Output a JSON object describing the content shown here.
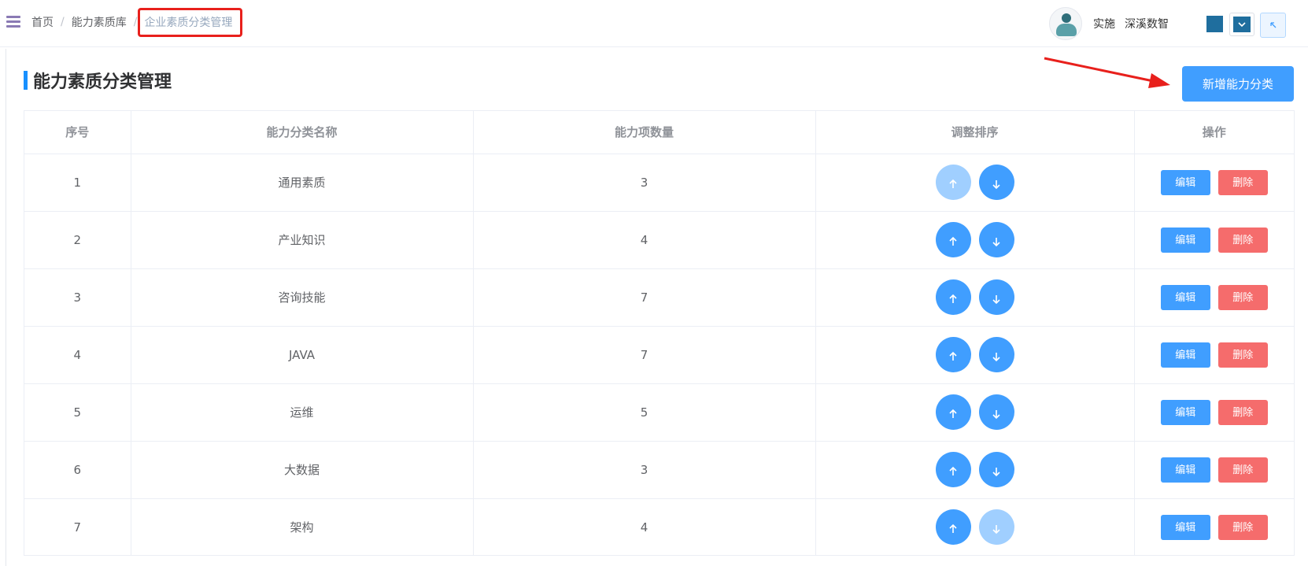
{
  "breadcrumb": {
    "items": [
      "首页",
      "能力素质库"
    ],
    "separator": "/",
    "current": "企业素质分类管理"
  },
  "user": {
    "role": "实施",
    "company": "深溪数智"
  },
  "page": {
    "title": "能力素质分类管理",
    "add_button": "新增能力分类"
  },
  "table": {
    "headers": [
      "序号",
      "能力分类名称",
      "能力项数量",
      "调整排序",
      "操作"
    ],
    "rows": [
      {
        "index": "1",
        "name": "通用素质",
        "count": "3",
        "up_disabled": true,
        "down_disabled": false
      },
      {
        "index": "2",
        "name": "产业知识",
        "count": "4",
        "up_disabled": false,
        "down_disabled": false
      },
      {
        "index": "3",
        "name": "咨询技能",
        "count": "7",
        "up_disabled": false,
        "down_disabled": false
      },
      {
        "index": "4",
        "name": "JAVA",
        "count": "7",
        "up_disabled": false,
        "down_disabled": false
      },
      {
        "index": "5",
        "name": "运维",
        "count": "5",
        "up_disabled": false,
        "down_disabled": false
      },
      {
        "index": "6",
        "name": "大数据",
        "count": "3",
        "up_disabled": false,
        "down_disabled": false
      },
      {
        "index": "7",
        "name": "架构",
        "count": "4",
        "up_disabled": false,
        "down_disabled": true
      }
    ],
    "edit_label": "编辑",
    "delete_label": "删除"
  },
  "icons": {
    "menu": "hamburger-icon",
    "up": "arrow-up-icon",
    "down": "arrow-down-icon",
    "dropdown": "chevron-down-icon",
    "fullscreen": "arrow-up-left-icon"
  },
  "colors": {
    "primary": "#409eff",
    "primary_disabled": "#a0cfff",
    "danger": "#f56c6c",
    "title_bar": "#1890ff",
    "theme_swatch": "#1f6e9e",
    "annotation_red": "#e8201c"
  }
}
